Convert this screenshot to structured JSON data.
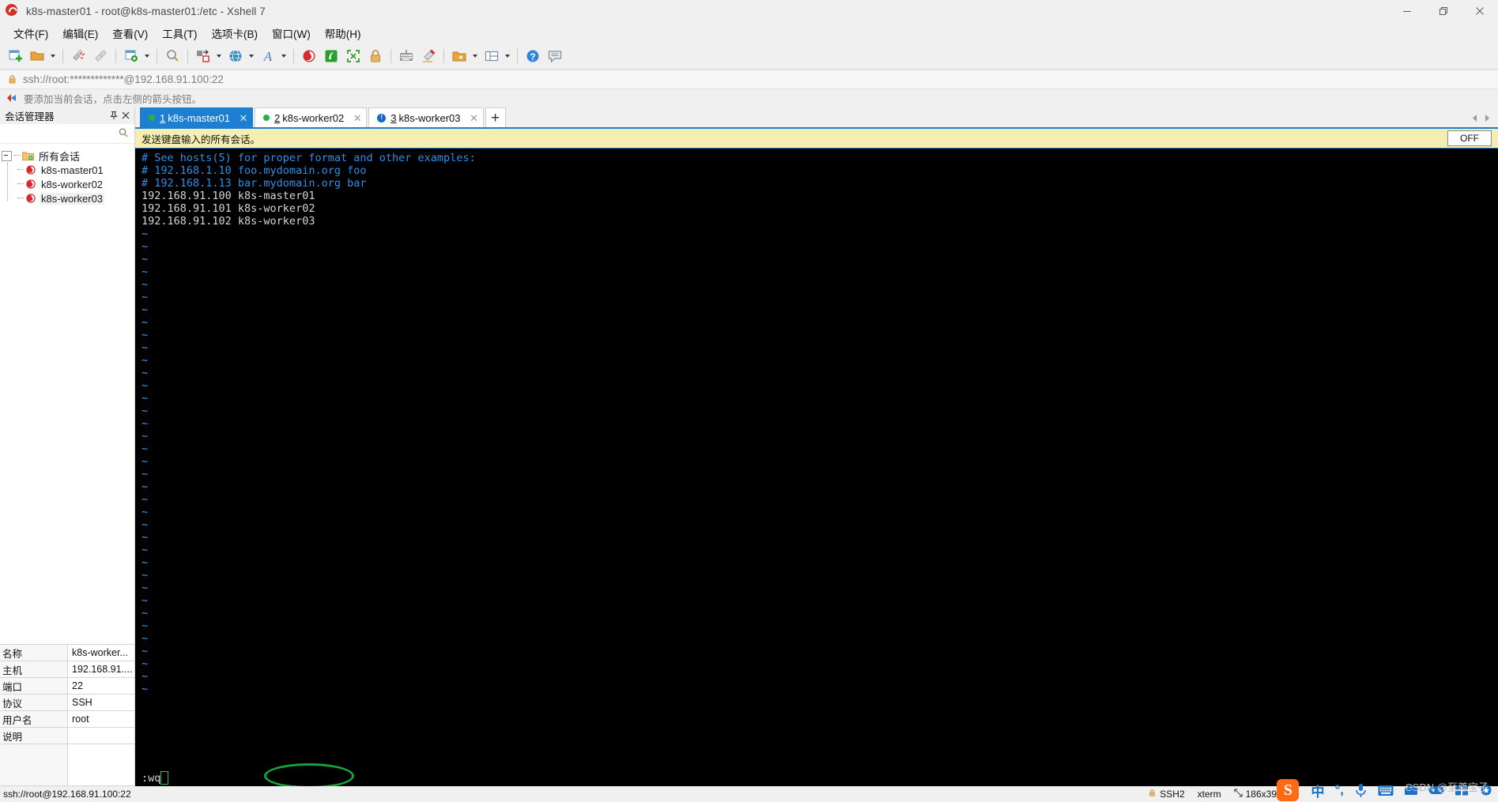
{
  "window": {
    "title": "k8s-master01 - root@k8s-master01:/etc - Xshell 7",
    "app_icon": "xshell-logo-icon",
    "minimize_label": "—",
    "maximize_label": "❐",
    "close_label": "✕"
  },
  "menu": {
    "items": [
      {
        "label": "文件(F)"
      },
      {
        "label": "编辑(E)"
      },
      {
        "label": "查看(V)"
      },
      {
        "label": "工具(T)"
      },
      {
        "label": "选项卡(B)"
      },
      {
        "label": "窗口(W)"
      },
      {
        "label": "帮助(H)"
      }
    ]
  },
  "toolbar": {
    "buttons": [
      {
        "name": "new-session-icon",
        "caret": false
      },
      {
        "name": "open-folder-icon",
        "caret": true
      },
      {
        "name": "disconnect-icon",
        "caret": false
      },
      {
        "name": "reconnect-icon",
        "caret": false
      },
      {
        "name": "session-properties-icon",
        "caret": true
      },
      {
        "name": "find-icon",
        "caret": false
      },
      {
        "name": "file-transfer-icon",
        "caret": true
      },
      {
        "name": "globe-icon",
        "caret": true
      },
      {
        "name": "font-icon",
        "caret": true
      },
      {
        "name": "xftp-icon",
        "caret": false
      },
      {
        "name": "xagent-icon",
        "caret": false
      },
      {
        "name": "fullscreen-icon",
        "caret": false
      },
      {
        "name": "lock-icon",
        "caret": false
      },
      {
        "name": "keyboard-icon",
        "caret": false
      },
      {
        "name": "highlight-pen-icon",
        "caret": false
      },
      {
        "name": "add-folder-icon",
        "caret": true
      },
      {
        "name": "layout-icon",
        "caret": true
      },
      {
        "name": "help-icon",
        "caret": false
      },
      {
        "name": "feedback-icon",
        "caret": false
      }
    ]
  },
  "urlbar": {
    "lock_icon": "lock-icon",
    "address": "ssh://root:*************@192.168.91.100:22"
  },
  "hintbar": {
    "arrow_icon": "red-arrow-icon",
    "text": "要添加当前会话，点击左侧的箭头按钮。"
  },
  "session_panel": {
    "title": "会话管理器",
    "pin_icon": "pin-icon",
    "close_icon": "close-icon",
    "search_icon": "search-icon",
    "tree": {
      "root_label": "所有会话",
      "root_icon": "folder-sessions-icon",
      "children": [
        {
          "label": "k8s-master01",
          "icon": "session-icon",
          "selected": false
        },
        {
          "label": "k8s-worker02",
          "icon": "session-icon",
          "selected": false
        },
        {
          "label": "k8s-worker03",
          "icon": "session-icon",
          "selected": true
        }
      ]
    },
    "properties": [
      {
        "key": "名称",
        "value": "k8s-worker..."
      },
      {
        "key": "主机",
        "value": "192.168.91...."
      },
      {
        "key": "端口",
        "value": "22"
      },
      {
        "key": "协议",
        "value": "SSH"
      },
      {
        "key": "用户名",
        "value": "root"
      },
      {
        "key": "说明",
        "value": ""
      }
    ]
  },
  "tabs": {
    "items": [
      {
        "num": "1",
        "label": "k8s-master01",
        "status": "connected",
        "active": true,
        "close_label": "✕"
      },
      {
        "num": "2",
        "label": "k8s-worker02",
        "status": "connected",
        "active": false,
        "close_label": "✕"
      },
      {
        "num": "3",
        "label": "k8s-worker03",
        "status": "alert",
        "active": false,
        "close_label": "✕"
      }
    ],
    "add_label": "+",
    "scroll_left_icon": "chevron-left-icon",
    "scroll_right_icon": "chevron-right-icon"
  },
  "notify_bar": {
    "text": "发送键盘输入的所有会话。",
    "toggle_label": "OFF"
  },
  "terminal": {
    "lines": [
      {
        "text": "# See hosts(5) for proper format and other examples:",
        "kind": "comment"
      },
      {
        "text": "# 192.168.1.10 foo.mydomain.org foo",
        "kind": "comment"
      },
      {
        "text": "# 192.168.1.13 bar.mydomain.org bar",
        "kind": "comment"
      },
      {
        "text": "192.168.91.100 k8s-master01",
        "kind": "text"
      },
      {
        "text": "192.168.91.101 k8s-worker02",
        "kind": "text"
      },
      {
        "text": "192.168.91.102 k8s-worker03",
        "kind": "text"
      }
    ],
    "tilde_count": 37,
    "tilde_char": "~",
    "command": ":wq",
    "annotation_shape": "green-ellipse",
    "colors": {
      "background": "#000000",
      "comment": "#2d8fe8",
      "text": "#d6d6d6",
      "tilde": "#3aa0f0",
      "cursor_border": "#3cb44a",
      "annotation": "#18a33a"
    }
  },
  "statusbar": {
    "connection": "ssh://root@192.168.91.100:22",
    "security": "SSH2",
    "security_icon": "lock-icon",
    "terminal_type": "xterm",
    "size_icon": "size-icon",
    "size": "186x39"
  },
  "ime_tray": {
    "logo_label": "S",
    "items": [
      {
        "name": "input-mode-chinese",
        "label": "中"
      },
      {
        "name": "punctuation-mode-icon",
        "label": "°,"
      },
      {
        "name": "voice-input-icon",
        "label": ""
      },
      {
        "name": "soft-keyboard-icon",
        "label": ""
      },
      {
        "name": "toolbox-icon",
        "label": ""
      },
      {
        "name": "games-icon",
        "label": ""
      },
      {
        "name": "skin-icon",
        "label": ""
      },
      {
        "name": "more-icon",
        "label": ""
      }
    ]
  },
  "watermark": {
    "text": "CSDN @至尊宝子"
  }
}
